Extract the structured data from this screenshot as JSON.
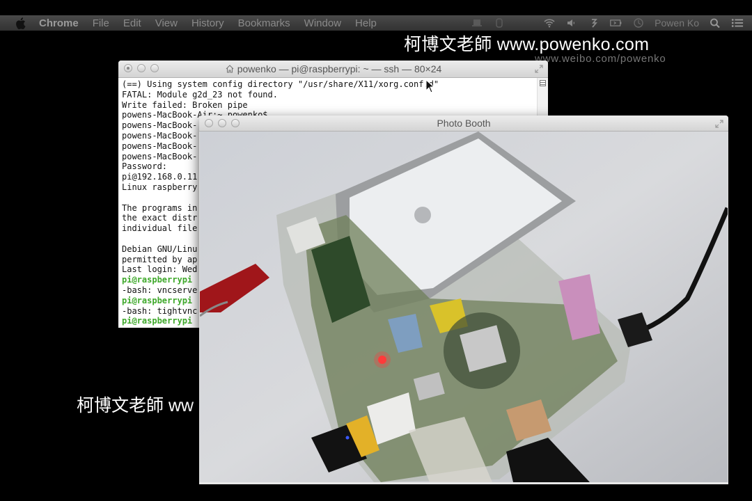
{
  "menubar": {
    "app_name": "Chrome",
    "items": [
      "File",
      "Edit",
      "View",
      "History",
      "Bookmarks",
      "Window",
      "Help"
    ],
    "status_icons": [
      "dropbox-icon",
      "skype-icon",
      "wifi-icon",
      "volume-icon",
      "time-machine-icon",
      "battery-icon",
      "clock-icon"
    ],
    "user_name": "Powen Ko",
    "search_icon": "spotlight-search-icon",
    "list_icon": "notification-center-icon"
  },
  "watermarks": {
    "top": "柯博文老師 www.powenko.com",
    "weibo": "www.weibo.com/powenko",
    "bottom": "柯博文老師 ww"
  },
  "terminal": {
    "title": "powenko — pi@raspberrypi: ~ — ssh — 80×24",
    "lines": [
      {
        "text": "(==) Using system config directory \"/usr/share/X11/xorg.conf.d\"",
        "prompt": false
      },
      {
        "text": "FATAL: Module g2d_23 not found.",
        "prompt": false
      },
      {
        "text": "Write failed: Broken pipe",
        "prompt": false
      },
      {
        "text": "powens-MacBook-Air:~ powenko$",
        "prompt": false
      },
      {
        "text": "powens-MacBook-",
        "prompt": false
      },
      {
        "text": "powens-MacBook-",
        "prompt": false
      },
      {
        "text": "powens-MacBook-",
        "prompt": false
      },
      {
        "text": "powens-MacBook-",
        "prompt": false
      },
      {
        "text": "Password:",
        "prompt": false
      },
      {
        "text": "pi@192.168.0.11",
        "prompt": false
      },
      {
        "text": "Linux raspberry",
        "prompt": false
      },
      {
        "text": "",
        "prompt": false
      },
      {
        "text": "The programs in",
        "prompt": false
      },
      {
        "text": "the exact distr",
        "prompt": false
      },
      {
        "text": "individual file",
        "prompt": false
      },
      {
        "text": "",
        "prompt": false
      },
      {
        "text": "Debian GNU/Linu",
        "prompt": false
      },
      {
        "text": "permitted by ap",
        "prompt": false
      },
      {
        "text": "Last login: Wed",
        "prompt": false
      },
      {
        "text": "pi@raspberrypi",
        "prompt": true
      },
      {
        "text": "-bash: vncserve",
        "prompt": false
      },
      {
        "text": "pi@raspberrypi",
        "prompt": true
      },
      {
        "text": "-bash: tightvnc",
        "prompt": false
      },
      {
        "text": "pi@raspberrypi",
        "prompt": true
      }
    ],
    "prompt_color": "#3ea82a"
  },
  "photobooth": {
    "title": "Photo Booth",
    "scene": "Raspberry Pi in clear case with 2.5\" hard drive, USB cables and red LED"
  }
}
